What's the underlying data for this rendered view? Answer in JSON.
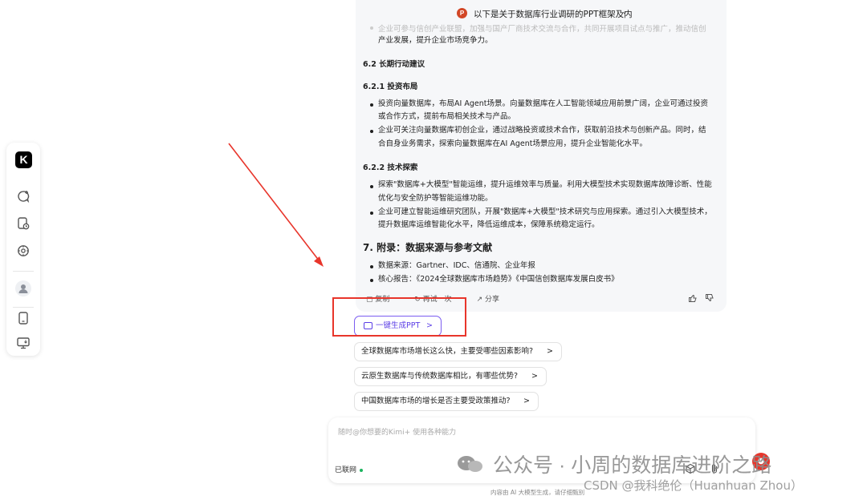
{
  "header": {
    "title": "以下是关于数据库行业调研的PPT框架及内"
  },
  "sidebar": {
    "logo": "K"
  },
  "content": {
    "faded_top": "企业可参与信创产业联盟，加强与国产厂商技术交流与合作，共同开展项目试点与推广，推动信创",
    "faded_top2": "产业发展，提升企业市场竞争力。",
    "h_6_2": "6.2 长期行动建议",
    "h_6_2_1": "6.2.1 投资布局",
    "b1_l1": "投资向量数据库，布局AI Agent场景。向量数据库在人工智能领域应用前景广阔，企业可通过投资",
    "b1_l2": "或合作方式，提前布局相关技术与产品。",
    "b2_l1": "企业可关注向量数据库初创企业，通过战略投资或技术合作，获取前沿技术与创新产品。同时，结",
    "b2_l2": "合自身业务需求，探索向量数据库在AI Agent场景应用，提升企业智能化水平。",
    "h_6_2_2": "6.2.2 技术探索",
    "b3_l1": "探索\"数据库+大模型\"智能运维，提升运维效率与质量。利用大模型技术实现数据库故障诊断、性能",
    "b3_l2": "优化与安全防护等智能运维功能。",
    "b4_l1": "企业可建立智能运维研究团队，开展\"数据库+大模型\"技术研究与应用探索。通过引入大模型技术，",
    "b4_l2": "提升数据库运维智能化水平，降低运维成本，保障系统稳定运行。",
    "h_7": "7. 附录：数据来源与参考文献",
    "b5": "数据来源：Gartner、IDC、信通院、企业年报",
    "b6": "核心报告：《2024全球数据库市场趋势》《中国信创数据库发展白皮书》"
  },
  "actions": {
    "copy": "复制",
    "retry": "再试一次",
    "share": "分享"
  },
  "ppt_button": {
    "label": "一键生成PPT",
    "chevron": ">"
  },
  "suggestions": [
    {
      "text": "全球数据库市场增长这么快，主要受哪些因素影响?",
      "chevron": ">"
    },
    {
      "text": "云原生数据库与传统数据库相比，有哪些优势?",
      "chevron": ">"
    },
    {
      "text": "中国数据库市场的增长是否主要受政策推动?",
      "chevron": ">"
    }
  ],
  "input": {
    "placeholder": "随时@你想要的Kimi+ 使用各种能力",
    "network_label": "已联网"
  },
  "footer": {
    "text": "内容由 AI 大模型生成，请仔细甄别"
  },
  "watermark": {
    "main": "公众号 · 小周的数据库进阶之路",
    "csdn": "CSDN @我科绝伦（Huanhuan Zhou）"
  },
  "colors": {
    "accent_purple": "#5b3ee6",
    "red_annotation": "#e8352b",
    "network_green": "#1bb35e"
  }
}
